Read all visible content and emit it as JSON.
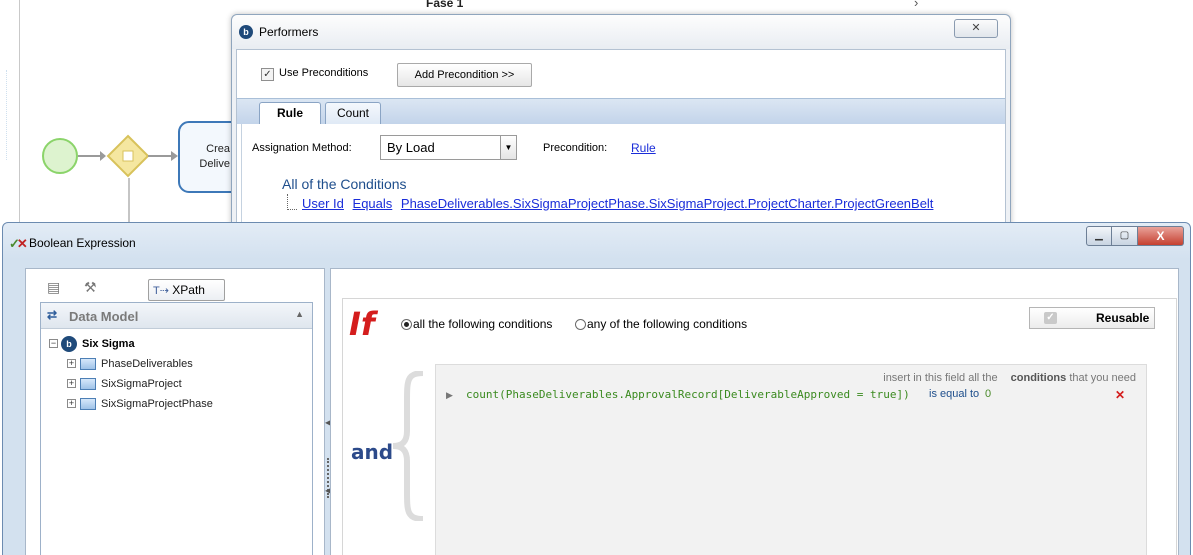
{
  "canvas": {
    "phase_title": "Fase 1",
    "phase_chevron": "›",
    "task_label": "Crea Delive"
  },
  "performers_dialog": {
    "title": "Performers",
    "close_glyph": "✕",
    "use_preconditions_label": "Use Preconditions",
    "use_preconditions_checked": true,
    "add_precondition_label": "Add Precondition >>",
    "tabs": [
      {
        "label": "Rule",
        "active": true
      },
      {
        "label": "Count",
        "active": false
      }
    ],
    "assignation_method_label": "Assignation Method:",
    "assignation_method_value": "By Load",
    "precondition_label": "Precondition:",
    "precondition_link": "Rule",
    "conditions_header": "All of the Conditions",
    "condition": {
      "field": "User Id",
      "operator": "Equals",
      "value": "PhaseDeliverables.SixSigmaProjectPhase.SixSigmaProject.ProjectCharter.ProjectGreenBelt"
    }
  },
  "boolean_expression": {
    "title": "Boolean Expression",
    "window_controls": {
      "minimize": "▁",
      "maximize": "▢",
      "close": "X"
    },
    "toolbar": {
      "xpath_label": "XPath"
    },
    "data_model": {
      "header": "Data Model",
      "root": "Six Sigma",
      "children": [
        "PhaseDeliverables",
        "SixSigmaProject",
        "SixSigmaProjectPhase"
      ]
    },
    "if_label": "If",
    "radio_all_label": "all the following conditions",
    "radio_any_label": "any of the following conditions",
    "selected_mode": "all",
    "reusable_label": "Reusable",
    "and_label": "and",
    "hint_prefix": "insert in this field all the",
    "hint_bold": "conditions",
    "hint_suffix": "that you need",
    "expression": {
      "left": "count(PhaseDeliverables.ApprovalRecord[DeliverableApproved = true])",
      "operator": "is equal to",
      "value": "0",
      "delete_glyph": "✕"
    }
  },
  "colors": {
    "if_red": "#d41d1d",
    "and_blue": "#2c4a8a",
    "link_blue": "#1a2dd9",
    "expr_green": "#3a8a1f",
    "gateway_yellow": "#f5e7a0",
    "start_green": "#8bd46a"
  }
}
